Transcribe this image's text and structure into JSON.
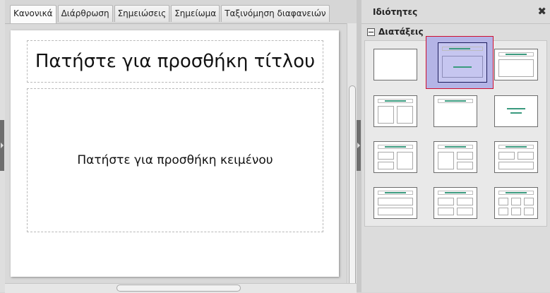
{
  "tabs": [
    {
      "label": "Κανονικά",
      "active": true
    },
    {
      "label": "Διάρθρωση",
      "active": false
    },
    {
      "label": "Σημειώσεις",
      "active": false
    },
    {
      "label": "Σημείωμα",
      "active": false
    },
    {
      "label": "Ταξινόμηση διαφανειών",
      "active": false
    }
  ],
  "slide": {
    "title_placeholder": "Πατήστε για προσθήκη τίτλου",
    "body_placeholder": "Πατήστε για προσθήκη κειμένου"
  },
  "panel": {
    "title": "Ιδιότητες",
    "close_icon": "close-icon",
    "section_label": "Διατάξεις",
    "section_expanded": true,
    "layouts": [
      {
        "name": "blank",
        "selected": false
      },
      {
        "name": "title-content",
        "selected": true
      },
      {
        "name": "title-content-box",
        "selected": false
      },
      {
        "name": "title-two-content",
        "selected": false
      },
      {
        "name": "title-only",
        "selected": false
      },
      {
        "name": "centered-text",
        "selected": false
      },
      {
        "name": "title-2-content-and-content",
        "selected": false
      },
      {
        "name": "title-content-and-2-content",
        "selected": false
      },
      {
        "name": "title-2-content-over-content",
        "selected": false
      },
      {
        "name": "title-content-over-content",
        "selected": false
      },
      {
        "name": "title-4-content",
        "selected": false
      },
      {
        "name": "title-6-content",
        "selected": false
      }
    ]
  },
  "colors": {
    "accent_line": "#3a9a7e",
    "selection_bg": "#b4b4e6",
    "selection_border": "#d01030"
  }
}
